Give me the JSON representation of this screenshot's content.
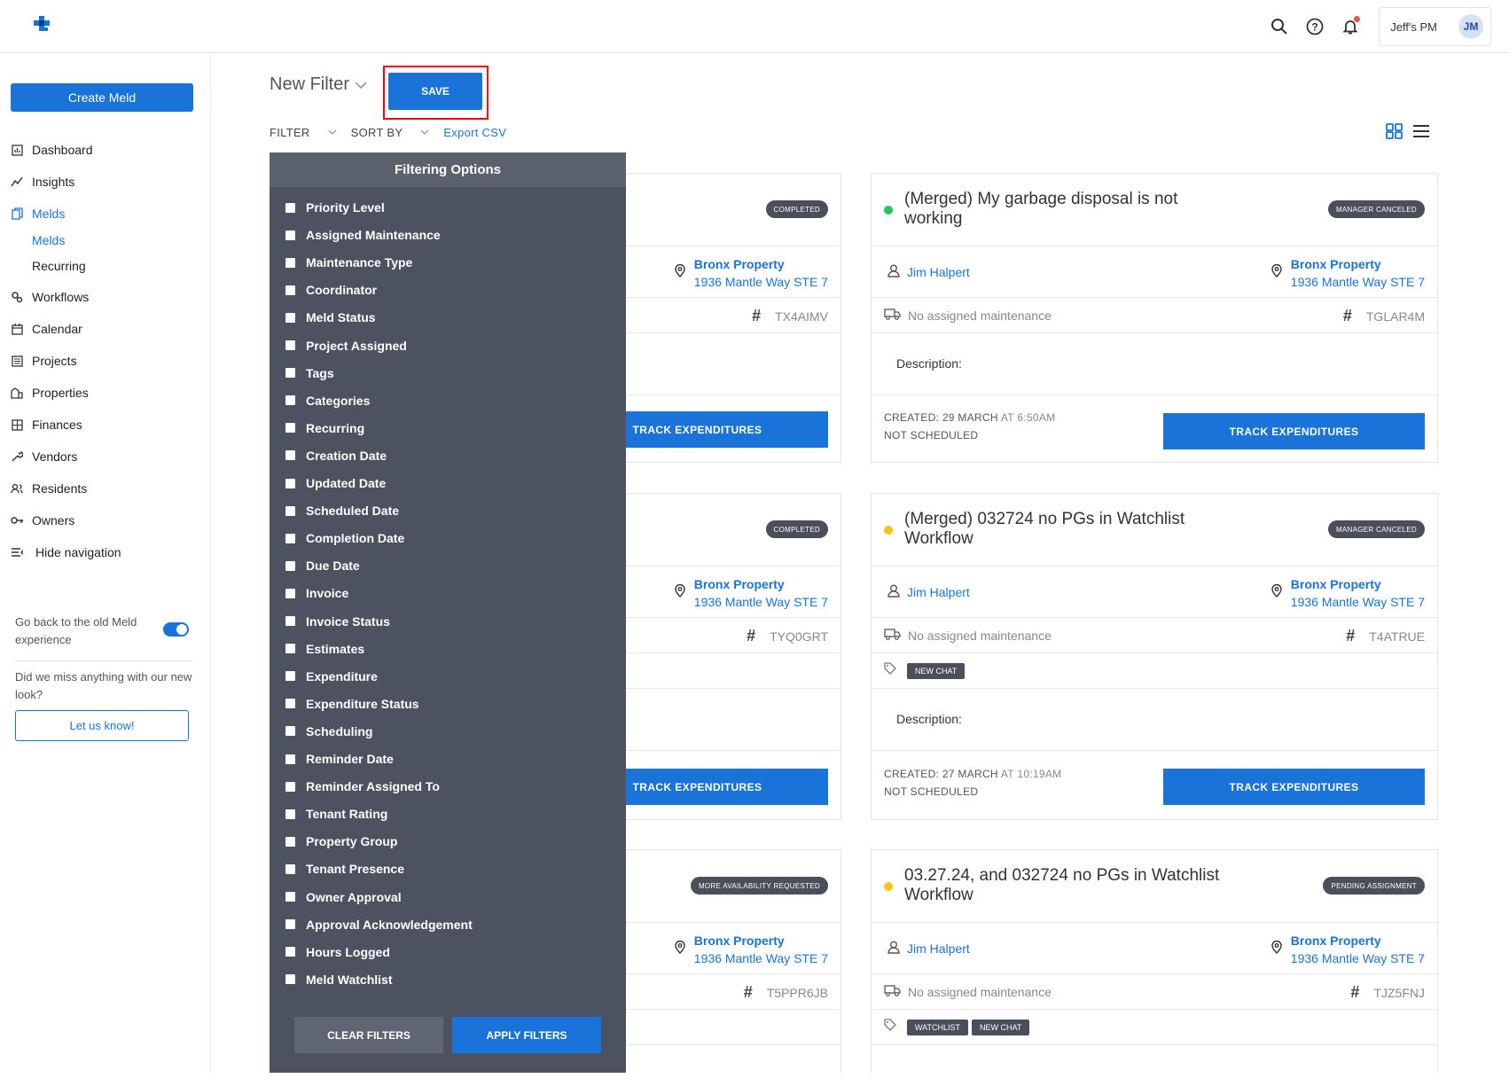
{
  "topbar": {
    "user_name": "Jeff's PM",
    "avatar_initials": "JM"
  },
  "sidebar": {
    "create_label": "Create Meld",
    "items": [
      {
        "label": "Dashboard",
        "icon": "dashboard-icon"
      },
      {
        "label": "Insights",
        "icon": "insights-icon"
      },
      {
        "label": "Melds",
        "icon": "melds-icon"
      },
      {
        "label": "Workflows",
        "icon": "workflows-icon"
      },
      {
        "label": "Calendar",
        "icon": "calendar-icon"
      },
      {
        "label": "Projects",
        "icon": "projects-icon"
      },
      {
        "label": "Properties",
        "icon": "properties-icon"
      },
      {
        "label": "Finances",
        "icon": "finances-icon"
      },
      {
        "label": "Vendors",
        "icon": "vendors-icon"
      },
      {
        "label": "Residents",
        "icon": "residents-icon"
      },
      {
        "label": "Owners",
        "icon": "owners-icon"
      },
      {
        "label": "Hide navigation",
        "icon": "hide-navigation-icon"
      }
    ],
    "sub_items": [
      "Melds",
      "Recurring"
    ],
    "old_experience_text": "Go back to the old Meld experience",
    "missed_text": "Did we miss anything with our new look?",
    "let_us_know": "Let us know!"
  },
  "main": {
    "filter_name": "New Filter",
    "save_label": "SAVE",
    "filter_label": "FILTER",
    "sort_label": "SORT BY",
    "export_label": "Export CSV"
  },
  "filtering": {
    "title": "Filtering Options",
    "options": [
      "Priority Level",
      "Assigned Maintenance",
      "Maintenance Type",
      "Coordinator",
      "Meld Status",
      "Project Assigned",
      "Tags",
      "Categories",
      "Recurring",
      "Creation Date",
      "Updated Date",
      "Scheduled Date",
      "Completion Date",
      "Due Date",
      "Invoice",
      "Invoice Status",
      "Estimates",
      "Expenditure",
      "Expenditure Status",
      "Scheduling",
      "Reminder Date",
      "Reminder Assigned To",
      "Tenant Rating",
      "Property Group",
      "Tenant Presence",
      "Owner Approval",
      "Approval Acknowledgement",
      "Hours Logged",
      "Meld Watchlist"
    ],
    "clear_label": "CLEAR FILTERS",
    "apply_label": "APPLY FILTERS"
  },
  "left_cards": [
    {
      "status": "COMPLETED",
      "property": "Bronx Property",
      "address": "1936 Mantle Way STE 7",
      "code": "TX4AIMV",
      "track": "TRACK EXPENDITURES"
    },
    {
      "status": "COMPLETED",
      "property": "Bronx Property",
      "address": "1936 Mantle Way STE 7",
      "code": "TYQ0GRT",
      "track": "TRACK EXPENDITURES"
    },
    {
      "status": "MORE AVAILABILITY REQUESTED",
      "property": "Bronx Property",
      "address": "1936 Mantle Way STE 7",
      "code": "T5PPR6JB"
    }
  ],
  "right_cards": [
    {
      "title": "(Merged) My garbage disposal is not working",
      "status": "MANAGER CANCELED",
      "dot_color": "#22c55e",
      "person": "Jim Halpert",
      "property": "Bronx Property",
      "address": "1936 Mantle Way STE 7",
      "maintenance": "No assigned maintenance",
      "code": "TGLAR4M",
      "description_label": "Description:",
      "created_label": "CREATED: 29 MARCH",
      "created_time": "AT 6:50AM",
      "schedule": "NOT SCHEDULED",
      "track": "TRACK EXPENDITURES",
      "tags": []
    },
    {
      "title": "(Merged) 032724 no PGs in Watchlist Workflow",
      "status": "MANAGER CANCELED",
      "dot_color": "#f5c518",
      "person": "Jim Halpert",
      "property": "Bronx Property",
      "address": "1936 Mantle Way STE 7",
      "maintenance": "No assigned maintenance",
      "code": "T4ATRUE",
      "description_label": "Description:",
      "created_label": "CREATED: 27 MARCH",
      "created_time": "AT 10:19AM",
      "schedule": "NOT SCHEDULED",
      "track": "TRACK EXPENDITURES",
      "tags": [
        "NEW CHAT"
      ]
    },
    {
      "title": "03.27.24, and 032724 no PGs in Watchlist Workflow",
      "status": "PENDING ASSIGNMENT",
      "dot_color": "#f5c518",
      "person": "Jim Halpert",
      "property": "Bronx Property",
      "address": "1936 Mantle Way STE 7",
      "maintenance": "No assigned maintenance",
      "code": "TJZ5FNJ",
      "tags": [
        "WATCHLIST",
        "NEW CHAT"
      ]
    }
  ]
}
